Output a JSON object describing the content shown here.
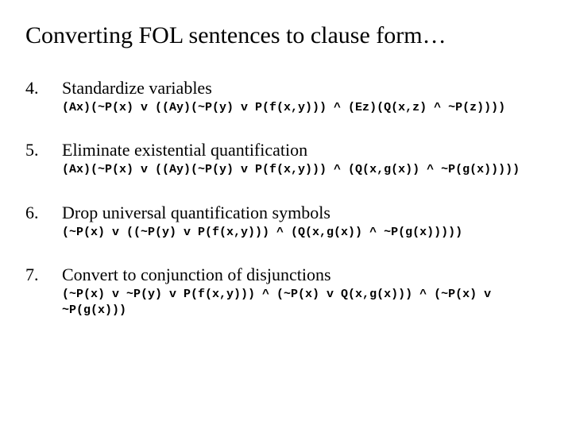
{
  "title": "Converting FOL sentences to clause form…",
  "items": [
    {
      "num": "4.",
      "heading": "Standardize variables",
      "formula": "(Ax)(~P(x) v ((Ay)(~P(y) v P(f(x,y))) ^ (Ez)(Q(x,z) ^ ~P(z))))"
    },
    {
      "num": "5.",
      "heading": "Eliminate existential quantification",
      "formula": "(Ax)(~P(x) v ((Ay)(~P(y) v P(f(x,y))) ^ (Q(x,g(x)) ^ ~P(g(x)))))"
    },
    {
      "num": "6.",
      "heading": "Drop universal quantification symbols",
      "formula": "(~P(x) v ((~P(y) v P(f(x,y))) ^ (Q(x,g(x)) ^ ~P(g(x)))))"
    },
    {
      "num": "7.",
      "heading": "Convert to conjunction of disjunctions",
      "formula": "(~P(x) v ~P(y) v P(f(x,y))) ^ (~P(x) v Q(x,g(x))) ^ (~P(x) v ~P(g(x)))"
    }
  ]
}
